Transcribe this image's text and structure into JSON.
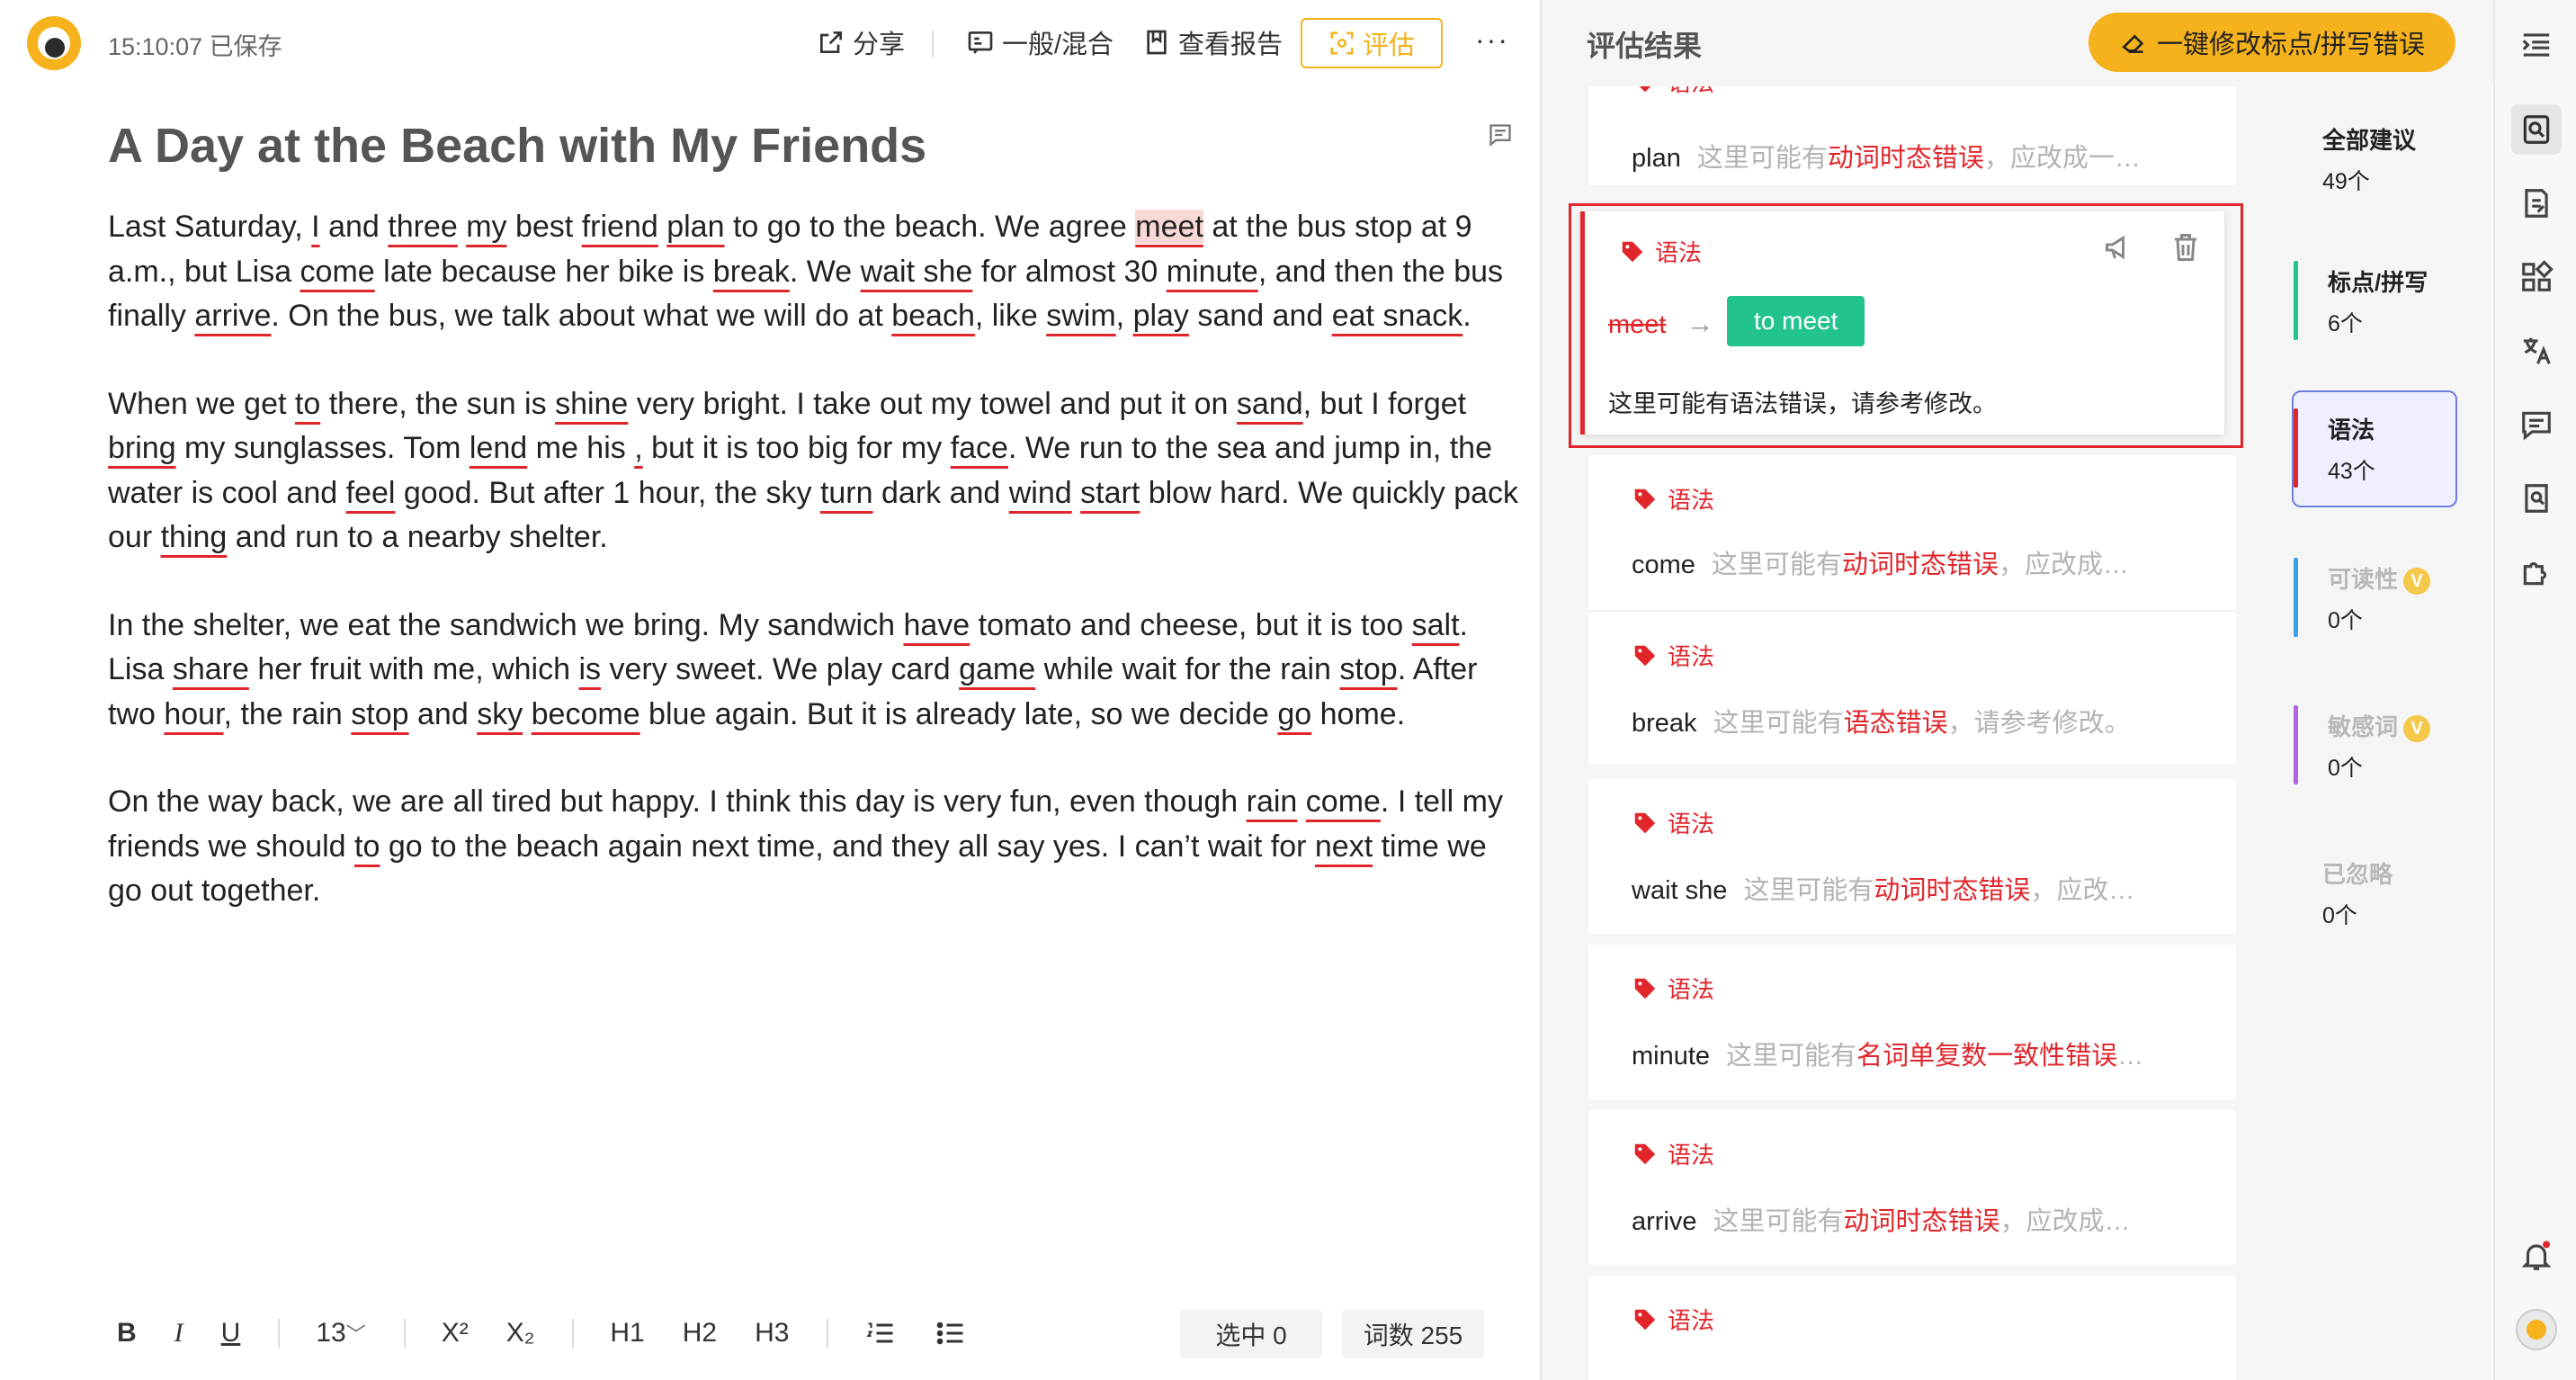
{
  "app": {
    "save_status": "15:10:07 已保存",
    "toolbar": {
      "share": "分享",
      "mode": "一般/混合",
      "report": "查看报告",
      "evaluate": "评估",
      "more": "···"
    }
  },
  "document": {
    "title": "A Day at the Beach with My Friends",
    "paragraphs": [
      [
        {
          "t": "Last Saturday, "
        },
        {
          "t": "I",
          "e": 1
        },
        {
          "t": " and "
        },
        {
          "t": "three",
          "e": 1
        },
        {
          "t": " "
        },
        {
          "t": "my",
          "e": 1
        },
        {
          "t": " best "
        },
        {
          "t": "friend",
          "e": 1
        },
        {
          "t": " "
        },
        {
          "t": "plan",
          "e": 1
        },
        {
          "t": " to go to the beach. We agree "
        },
        {
          "t": "meet",
          "e": 1,
          "hl": 1
        },
        {
          "t": " at the bus stop at 9 a.m., but Lisa "
        },
        {
          "t": "come",
          "e": 1
        },
        {
          "t": " late because her bike is "
        },
        {
          "t": "break",
          "e": 1
        },
        {
          "t": ". We "
        },
        {
          "t": "wait she",
          "e": 1
        },
        {
          "t": " for almost 30 "
        },
        {
          "t": "minute",
          "e": 1
        },
        {
          "t": ", and then the bus finally "
        },
        {
          "t": "arrive",
          "e": 1
        },
        {
          "t": ". On the bus, we talk about what we will do at "
        },
        {
          "t": "beach",
          "e": 1
        },
        {
          "t": ", like "
        },
        {
          "t": "swim",
          "e": 1
        },
        {
          "t": ", "
        },
        {
          "t": "play",
          "e": 1
        },
        {
          "t": " sand and "
        },
        {
          "t": "eat snack",
          "e": 1
        },
        {
          "t": "."
        }
      ],
      [
        {
          "t": "When we get "
        },
        {
          "t": "to",
          "e": 1
        },
        {
          "t": " there, the sun is "
        },
        {
          "t": "shine",
          "e": 1
        },
        {
          "t": " very bright. I take out my towel and put it on "
        },
        {
          "t": "sand",
          "e": 1
        },
        {
          "t": ", but I forget "
        },
        {
          "t": "bring",
          "e": 1
        },
        {
          "t": " my sunglasses. Tom "
        },
        {
          "t": "lend",
          "e": 1
        },
        {
          "t": " me  his "
        },
        {
          "t": ",",
          "e": 1
        },
        {
          "t": " but it is too big for my "
        },
        {
          "t": "face",
          "e": 1
        },
        {
          "t": ". We run to the sea and jump in, the water is cool and "
        },
        {
          "t": "feel",
          "e": 1
        },
        {
          "t": " good. But after 1 hour, the sky "
        },
        {
          "t": "turn",
          "e": 1
        },
        {
          "t": " dark and "
        },
        {
          "t": "wind",
          "e": 1
        },
        {
          "t": " "
        },
        {
          "t": "start",
          "e": 1
        },
        {
          "t": " blow hard. We quickly pack our "
        },
        {
          "t": "thing",
          "e": 1
        },
        {
          "t": " and run to a nearby shelter."
        }
      ],
      [
        {
          "t": "In the shelter, we eat the sandwich we bring. My sandwich "
        },
        {
          "t": "have",
          "e": 1
        },
        {
          "t": " tomato and cheese, but it is too "
        },
        {
          "t": "salt",
          "e": 1
        },
        {
          "t": ". Lisa "
        },
        {
          "t": "share",
          "e": 1
        },
        {
          "t": " her fruit with me, which "
        },
        {
          "t": "is",
          "e": 1
        },
        {
          "t": " very sweet. We play card "
        },
        {
          "t": "game",
          "e": 1
        },
        {
          "t": " while wait for the rain "
        },
        {
          "t": "stop",
          "e": 1
        },
        {
          "t": ". After two "
        },
        {
          "t": "hour",
          "e": 1
        },
        {
          "t": ", the rain "
        },
        {
          "t": "stop",
          "e": 1
        },
        {
          "t": " and "
        },
        {
          "t": "sky",
          "e": 1
        },
        {
          "t": " "
        },
        {
          "t": "become",
          "e": 1
        },
        {
          "t": " blue again. But it is already late, so we decide "
        },
        {
          "t": "go",
          "e": 1
        },
        {
          "t": " home."
        }
      ],
      [
        {
          "t": "On the way back, we are all tired but happy. I think this day is very fun, even though "
        },
        {
          "t": "rain",
          "e": 1
        },
        {
          "t": " "
        },
        {
          "t": "come",
          "e": 1
        },
        {
          "t": ". I tell my friends we should "
        },
        {
          "t": "to",
          "e": 1
        },
        {
          "t": " go to the beach again next time, and they all say yes. I can’t wait for "
        },
        {
          "t": "next",
          "e": 1
        },
        {
          "t": " time we go out together."
        }
      ]
    ]
  },
  "footer": {
    "bold": "B",
    "italic": "I",
    "underline": "U",
    "font_size": "13",
    "superscript": "X²",
    "subscript": "X₂",
    "h1": "H1",
    "h2": "H2",
    "h3": "H3",
    "selected": "选中 0",
    "word_count": "词数 255"
  },
  "results": {
    "title": "评估结果",
    "fix_button": "一键修改标点/拼写错误",
    "category_label": "语法",
    "cards": [
      {
        "word": "plan",
        "pre": "这里可能有",
        "err": "动词时态错误",
        "post": "，应改成一…"
      },
      {
        "word": "come",
        "pre": "这里可能有",
        "err": "动词时态错误",
        "post": "，应改成…"
      },
      {
        "word": "break",
        "pre": "这里可能有",
        "err": "语态错误",
        "post": "，请参考修改。"
      },
      {
        "word": "wait she",
        "pre": "这里可能有",
        "err": "动词时态错误",
        "post": "，应改…"
      },
      {
        "word": "minute",
        "pre": "这里可能有",
        "err": "名词单复数一致性错误",
        "post": "…"
      },
      {
        "word": "arrive",
        "pre": "这里可能有",
        "err": "动词时态错误",
        "post": "，应改成…"
      }
    ],
    "active": {
      "original": "meet",
      "arrow": "→",
      "suggestion": "to meet",
      "message": "这里可能有语法错误，请参考修改。"
    }
  },
  "categories": [
    {
      "name": "全部建议",
      "count": "49个"
    },
    {
      "name": "标点/拼写",
      "count": "6个",
      "color": "#22c38e"
    },
    {
      "name": "语法",
      "count": "43个",
      "color": "#e0262b"
    },
    {
      "name": "可读性",
      "count": "0个",
      "color": "#3aa0e8"
    },
    {
      "name": "敏感词",
      "count": "0个",
      "color": "#b066e0"
    },
    {
      "name": "已忽略",
      "count": "0个"
    }
  ],
  "colors": {
    "accent": "#f5b21c",
    "error": "#e0262b",
    "suggest": "#22c38e",
    "selected_category_border": "#6b7de0"
  }
}
